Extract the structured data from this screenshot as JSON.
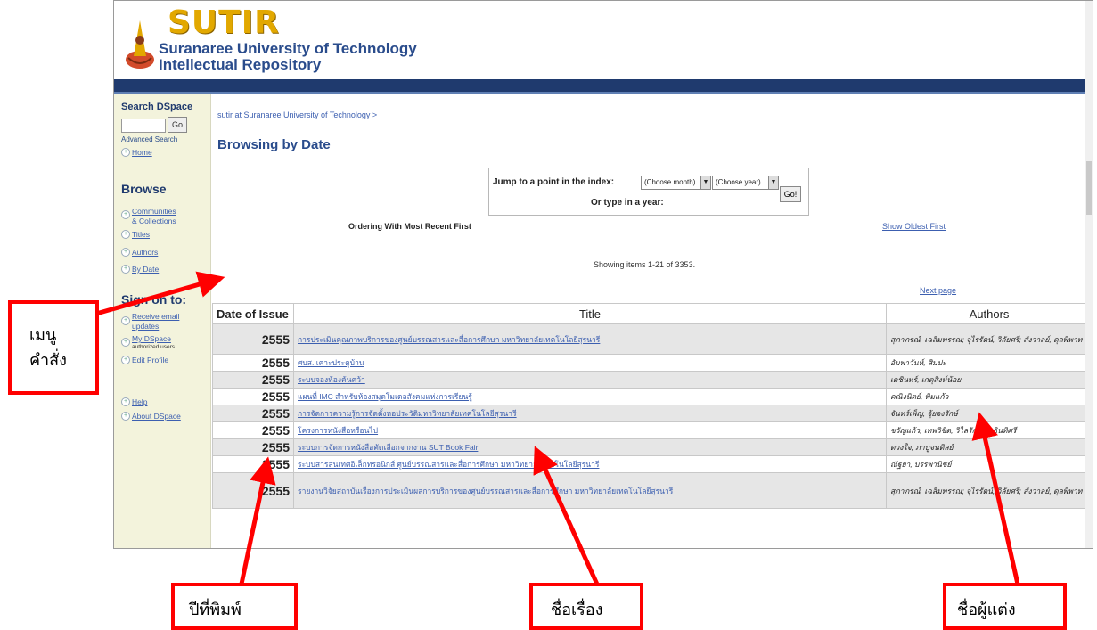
{
  "header": {
    "logo_text": "SUTIR",
    "subtitle_line1": "Suranaree University of Technology",
    "subtitle_line2": "Intellectual Repository"
  },
  "sidebar": {
    "search_title": "Search DSpace",
    "go_label": "Go",
    "advanced_search": "Advanced Search",
    "home": "Home",
    "browse_heading": "Browse",
    "communities_line1": "Communities",
    "communities_line2": "& Collections",
    "titles": "Titles",
    "authors": "Authors",
    "by_date": "By Date",
    "signon_heading": "Sign on to:",
    "receive_line1": "Receive email",
    "receive_line2": "updates",
    "mydspace": "My DSpace",
    "mydspace_sub": "authorized users",
    "edit_profile": "Edit Profile",
    "help": "Help",
    "about": "About DSpace"
  },
  "content": {
    "breadcrumb": "sutir at Suranaree University of Technology >",
    "page_title": "Browsing by Date",
    "jump_label": "Jump to a point in the index:",
    "month_select": "(Choose month)",
    "year_select": "(Choose year)",
    "jump_go": "Go!",
    "type_year_label": "Or type in a year:",
    "ordering": "Ordering With Most Recent First",
    "show_oldest": "Show Oldest First",
    "showing": "Showing items 1-21 of 3353.",
    "next_page": "Next page"
  },
  "table": {
    "headers": {
      "date": "Date of Issue",
      "title": "Title",
      "authors": "Authors"
    },
    "rows": [
      {
        "year": "2555",
        "title": "การประเมินคุณภาพบริการของศูนย์บรรณสารและสื่อการศึกษา มหาวิทยาลัยเทคโนโลยีสุรนารี",
        "authors": "สุภาภรณ์, เฉลิมพรรณ; จุไรรัตน์, วิลัยศรี; สังวาลย์, ดุลพิพาท"
      },
      {
        "year": "2555",
        "title": "ศบส. เคาะประตูบ้าน",
        "authors": "อัมพาวันห์, สิมปะ"
      },
      {
        "year": "2555",
        "title": "ระบบจองห้องค้นคว้า",
        "authors": "เดชินทร์, เกตุสิงห์น้อย"
      },
      {
        "year": "2555",
        "title": "แผนที่ IMC สำหรับห้องสมุดโมเดลสังคมแห่งการเรียนรู้",
        "authors": "คณิงนิตย์, พิมแก้ว"
      },
      {
        "year": "2555",
        "title": "การจัดการความรู้การจัดตั้งหอประวัติมหาวิทยาลัยเทคโนโลยีสุรนารี",
        "authors": "จันทร์เพ็ญ, จุ้ยจงรักษ์"
      },
      {
        "year": "2555",
        "title": "โครงการหนังสือหรือนไป",
        "authors": "ชวัญแก้ว, เทพวิชิต, วิไลรักษณ์, อินทิศรี"
      },
      {
        "year": "2555",
        "title": "ระบบการจัดการหนังสือคัดเลือกจากงาน SUT Book Fair",
        "authors": "ดวงใจ, ภาบูจนดิลย์"
      },
      {
        "year": "2555",
        "title": "ระบบสารสนเทศอิเล็กทรอนิกส์ ศูนย์บรรณสารและสื่อการศึกษา มหาวิทยาลัยเทคโนโลยีสุรนารี",
        "authors": "ณัฐยา, บรรพานิชย์"
      },
      {
        "year": "2555",
        "title": "รายงานวิจัยสถาบันเรื่องการประเมินผลการบริการของศูนย์บรรณสารและสื่อการศึกษา มหาวิทยาลัยเทคโนโลยีสุรนารี",
        "authors": "สุภาภรณ์, เฉลิมพรรณ; จุไรรัตน์, วิลัยศรี; สังวาลย์, ดุลพิพาท"
      }
    ]
  },
  "callouts": {
    "menu_line1": "เมนู",
    "menu_line2": "คำสั่ง",
    "year": "ปีที่พิมพ์",
    "title": "ชื่อเรื่อง",
    "author": "ชื่อผู้แต่ง"
  },
  "colors": {
    "accent": "#ff0000",
    "nav": "#1f3a6e",
    "link": "#3c5fb0",
    "logo": "#e2a800"
  }
}
